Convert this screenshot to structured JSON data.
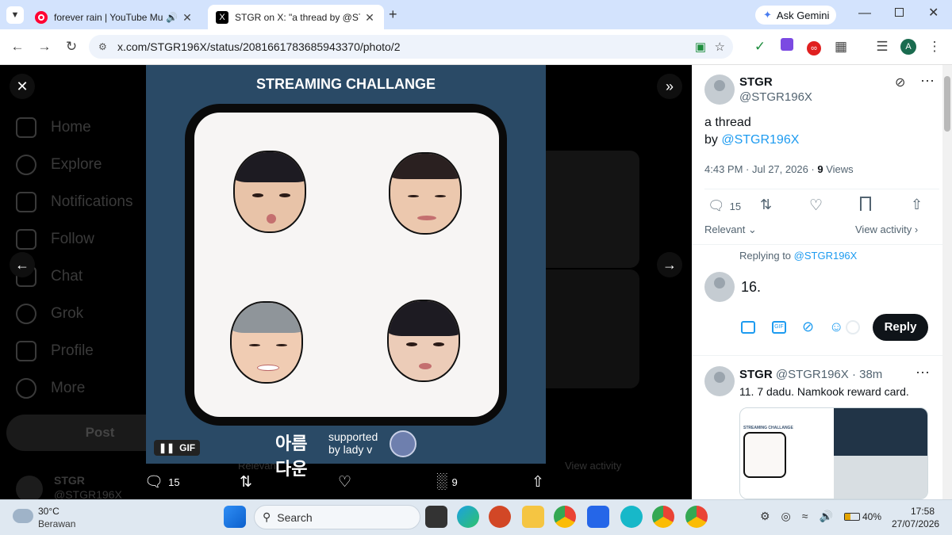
{
  "browser": {
    "tabs": [
      {
        "title": "forever rain | YouTube Music"
      },
      {
        "title": "STGR on X: \"a thread by @STGR"
      }
    ],
    "url": "x.com/STGR196X/status/2081661783685943370/photo/2",
    "gemini_label": "Ask Gemini",
    "profile_initial": "A"
  },
  "sidebar": {
    "items": [
      {
        "label": "Home"
      },
      {
        "label": "Explore"
      },
      {
        "label": "Notifications"
      },
      {
        "label": "Follow"
      },
      {
        "label": "Chat"
      },
      {
        "label": "Grok"
      },
      {
        "label": "Profile"
      },
      {
        "label": "More"
      }
    ],
    "post_button": "Post",
    "account_name": "STGR",
    "account_handle": "@STGR196X"
  },
  "media": {
    "title": "STREAMING CHALLANGE",
    "gif_label": "GIF",
    "logo_text": "아름다운",
    "supported_text": "supported by lady v"
  },
  "actions": {
    "replies": "15",
    "views": "9"
  },
  "background": {
    "relevant": "Relevant",
    "view_activity": "View activity"
  },
  "tweet": {
    "author": "STGR",
    "handle": "@STGR196X",
    "text_line1": "a thread",
    "text_by": "by ",
    "text_mention": "@STGR196X",
    "time": "4:43 PM · Jul 27, 2026 · ",
    "views_count": "9",
    "views_label": " Views",
    "reply_count": "15",
    "relevant": "Relevant",
    "view_activity": "View activity",
    "replying_prefix": "Replying to ",
    "replying_handle": "@STGR196X",
    "reply_draft": "16.",
    "reply_button": "Reply"
  },
  "reply_post": {
    "author": "STGR",
    "handle_time": "@STGR196X · 38m",
    "text": "11. 7 dadu. Namkook reward card.",
    "thumb_title": "STREAMING CHALLANGE"
  },
  "taskbar": {
    "temp": "30°C",
    "weather": "Berawan",
    "search": "Search",
    "battery": "40%",
    "time": "17:58",
    "date": "27/07/2026"
  },
  "colors": {
    "accent": "#1d9bf0",
    "media_bg": "#2a4a66",
    "tabstrip": "#d3e3fd"
  }
}
